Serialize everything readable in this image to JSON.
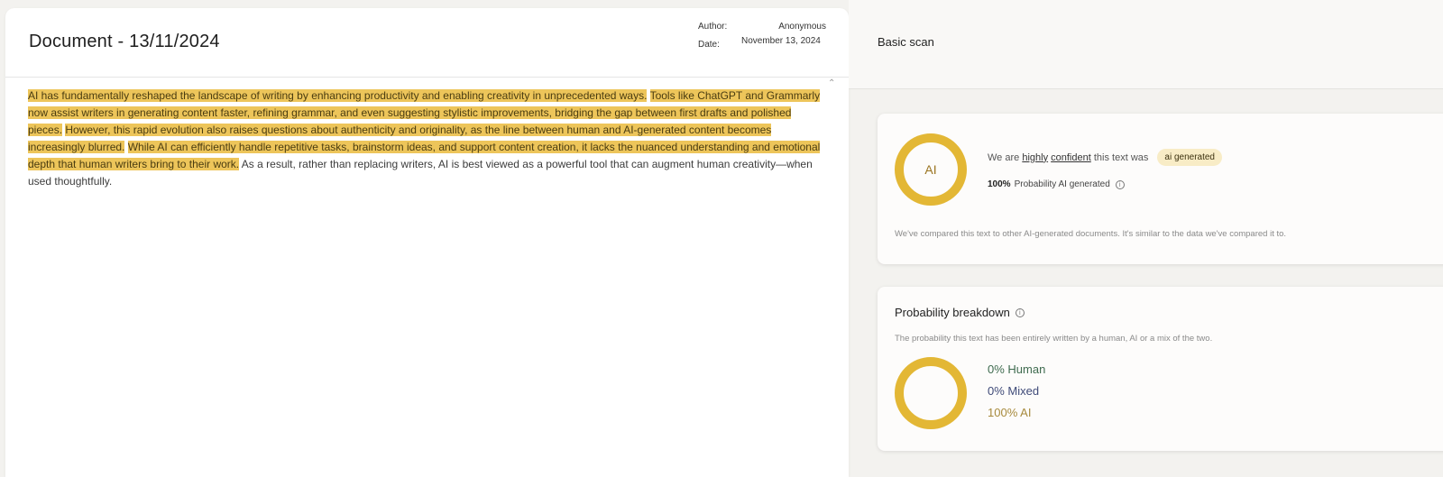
{
  "document": {
    "title": "Document - 13/11/2024",
    "author_label": "Author:",
    "author_value": "Anonymous",
    "date_label": "Date:",
    "date_value": "November 13, 2024",
    "sentences": [
      {
        "text": "AI has fundamentally reshaped the landscape of writing by enhancing productivity and enabling creativity in unprecedented ways.",
        "highlighted": true
      },
      {
        "text": "Tools like ChatGPT and Grammarly now assist writers in generating content faster, refining grammar, and even suggesting stylistic improvements, bridging the gap between first drafts and polished pieces.",
        "highlighted": true
      },
      {
        "text": "However, this rapid evolution also raises questions about authenticity and originality, as the line between human and AI-generated content becomes increasingly blurred.",
        "highlighted": true
      },
      {
        "text": "While AI can efficiently handle repetitive tasks, brainstorm ideas, and support content creation, it lacks the nuanced understanding and emotional depth that human writers bring to their work.",
        "highlighted": true
      },
      {
        "text": "As a result, rather than replacing writers, AI is best viewed as a powerful tool that can augment human creativity—when used thoughtfully.",
        "highlighted": false
      }
    ],
    "collapse_icon": "chevron-up-icon"
  },
  "scan": {
    "title": "Basic scan",
    "result": {
      "ring_label": "AI",
      "confidence_prefix": "We are",
      "confidence_word1": "highly",
      "confidence_word2": "confident",
      "confidence_suffix": "this text was",
      "badge": "ai generated",
      "probability_value": "100%",
      "probability_text": "Probability AI generated",
      "compare_note": "We've compared this text to other AI-generated documents. It's similar to the data we've compared it to."
    },
    "breakdown": {
      "title": "Probability breakdown",
      "description": "The probability this text has been entirely written by a human, AI or a mix of the two.",
      "human": "0% Human",
      "mixed": "0% Mixed",
      "ai": "100% AI",
      "human_fraction": 0,
      "mixed_fraction": 0,
      "ai_fraction": 1
    }
  },
  "colors": {
    "highlight": "#edc55a",
    "ring": "#e3b735",
    "badge_bg": "#f8ecc6",
    "human": "#3f6b4f",
    "mixed": "#3f4a78",
    "ai": "#a78a3c"
  }
}
